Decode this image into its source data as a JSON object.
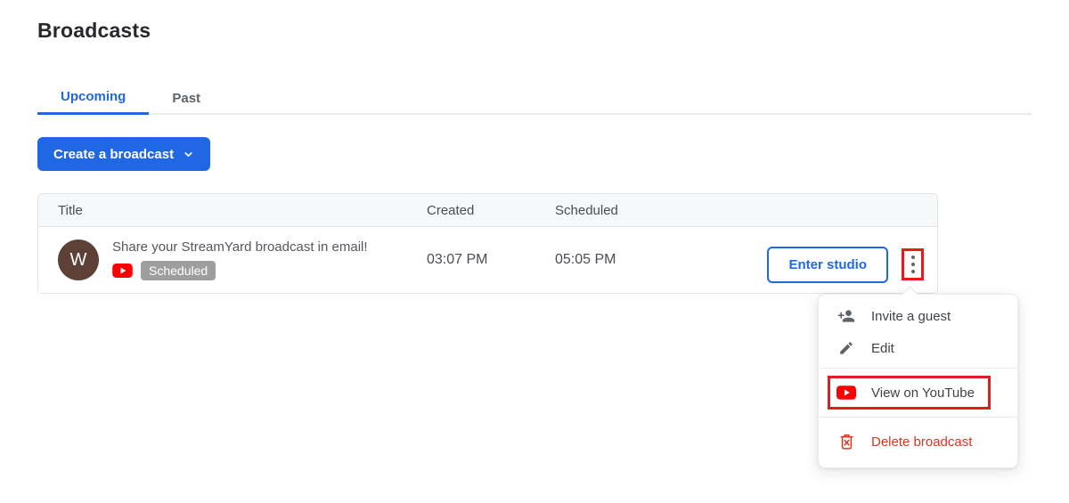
{
  "page": {
    "title": "Broadcasts"
  },
  "tabs": [
    {
      "label": "Upcoming",
      "active": true
    },
    {
      "label": "Past",
      "active": false
    }
  ],
  "create_button": {
    "label": "Create a broadcast",
    "icon": "chevron-down-icon"
  },
  "table": {
    "columns": [
      "Title",
      "Created",
      "Scheduled"
    ],
    "rows": [
      {
        "avatar_letter": "W",
        "title": "Share your StreamYard broadcast in email!",
        "platform_icon": "youtube-icon",
        "status_badge": "Scheduled",
        "created": "03:07 PM",
        "scheduled": "05:05 PM",
        "action_label": "Enter studio",
        "more_icon": "kebab-menu-icon"
      }
    ]
  },
  "menu": {
    "items": [
      {
        "label": "Invite a guest",
        "icon": "person-add-icon",
        "highlighted": false,
        "danger": false
      },
      {
        "label": "Edit",
        "icon": "pencil-icon",
        "highlighted": false,
        "danger": false
      },
      {
        "label": "View on YouTube",
        "icon": "youtube-icon",
        "highlighted": true,
        "danger": false
      },
      {
        "label": "Delete broadcast",
        "icon": "trash-icon",
        "highlighted": false,
        "danger": true
      }
    ]
  },
  "colors": {
    "accent_blue": "#2068e3",
    "annotation_red": "#e41b1b",
    "danger_red": "#d43a22",
    "youtube_red": "#ff0000",
    "badge_gray": "#9e9e9e",
    "avatar_brown": "#5d4037"
  }
}
